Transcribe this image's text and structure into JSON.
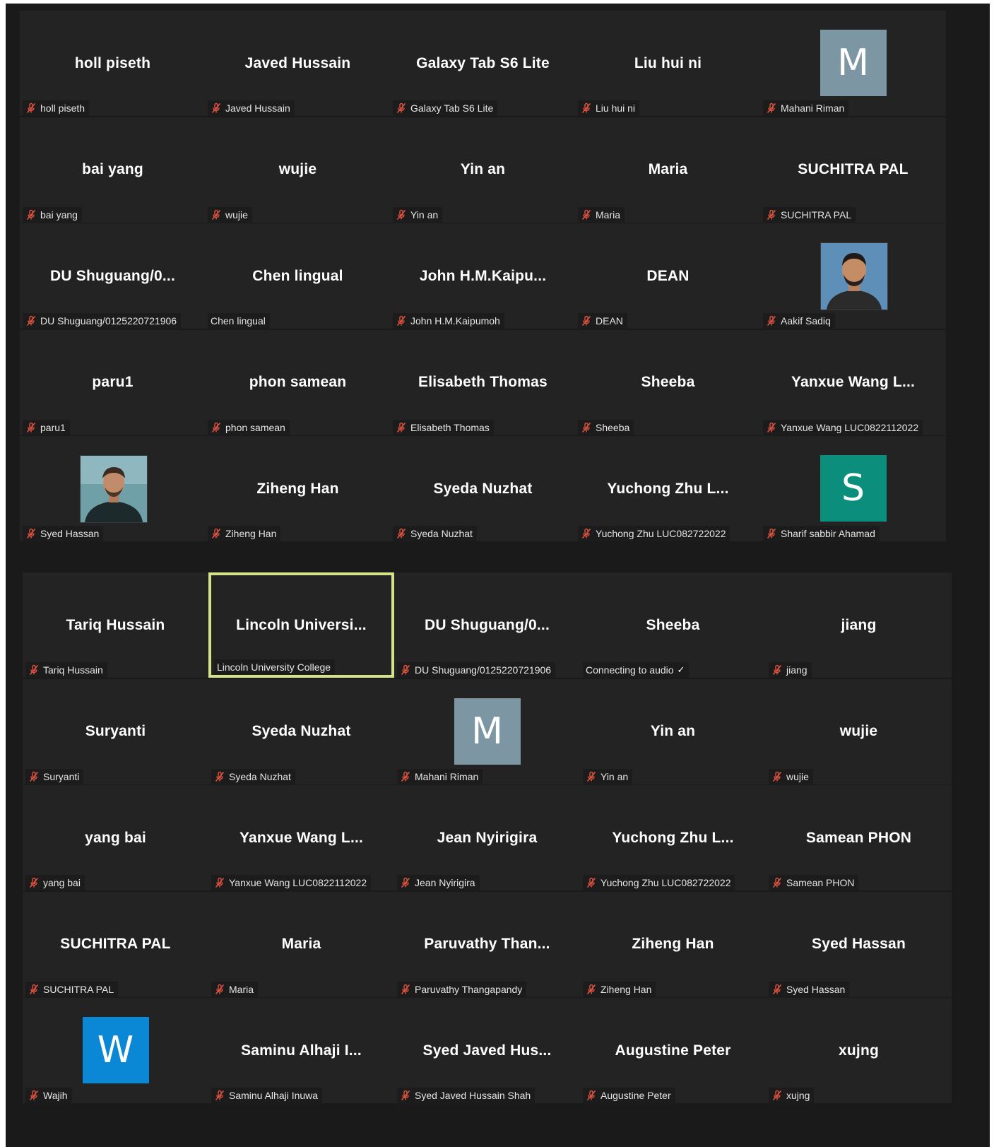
{
  "colors": {
    "background": "#1a1a1a",
    "tile": "#232323",
    "active_border": "#d3e38a",
    "mute_icon": "#e0533f",
    "avatar_gray": "#7d96a3",
    "avatar_teal": "#0c8e7d",
    "avatar_blue": "#0a88d6"
  },
  "top_grid": [
    {
      "display": "holl piseth",
      "label": "holl piseth",
      "muted": true
    },
    {
      "display": "Javed Hussain",
      "label": "Javed Hussain",
      "muted": true
    },
    {
      "display": "Galaxy Tab S6 Lite",
      "label": "Galaxy Tab S6 Lite",
      "muted": true
    },
    {
      "display": "Liu hui ni",
      "label": "Liu hui ni",
      "muted": true
    },
    {
      "display": "",
      "label": "Mahani Riman",
      "muted": true,
      "avatar": "M",
      "avatar_color": "#7d96a3"
    },
    {
      "display": "bai yang",
      "label": "bai yang",
      "muted": true
    },
    {
      "display": "wujie",
      "label": "wujie",
      "muted": true
    },
    {
      "display": "Yin an",
      "label": "Yin an",
      "muted": true
    },
    {
      "display": "Maria",
      "label": "Maria",
      "muted": true
    },
    {
      "display": "SUCHITRA PAL",
      "label": "SUCHITRA PAL",
      "muted": true
    },
    {
      "display": "DU  Shuguang/0...",
      "label": "DU Shuguang/0125220721906",
      "muted": true
    },
    {
      "display": "Chen lingual",
      "label": "Chen lingual",
      "muted": false
    },
    {
      "display": "John  H.M.Kaipu...",
      "label": "John H.M.Kaipumoh",
      "muted": true
    },
    {
      "display": "DEAN",
      "label": "DEAN",
      "muted": true
    },
    {
      "display": "",
      "label": "Aakif Sadiq",
      "muted": true,
      "photo": "profile-photo-a"
    },
    {
      "display": "paru1",
      "label": "paru1",
      "muted": true
    },
    {
      "display": "phon samean",
      "label": "phon samean",
      "muted": true
    },
    {
      "display": "Elisabeth Thomas",
      "label": "Elisabeth Thomas",
      "muted": true
    },
    {
      "display": "Sheeba",
      "label": "Sheeba",
      "muted": true
    },
    {
      "display": "Yanxue Wang L...",
      "label": "Yanxue Wang LUC0822112022",
      "muted": true
    },
    {
      "display": "",
      "label": "Syed Hassan",
      "muted": true,
      "photo": "profile-photo-b"
    },
    {
      "display": "Ziheng Han",
      "label": "Ziheng Han",
      "muted": true
    },
    {
      "display": "Syeda Nuzhat",
      "label": "Syeda Nuzhat",
      "muted": true
    },
    {
      "display": "Yuchong Zhu L...",
      "label": "Yuchong Zhu LUC082722022",
      "muted": true
    },
    {
      "display": "",
      "label": "Sharif sabbir Ahamad",
      "muted": true,
      "avatar": "S",
      "avatar_color": "#0c8e7d"
    }
  ],
  "bottom_grid": [
    {
      "display": "Tariq Hussain",
      "label": "Tariq Hussain",
      "muted": true
    },
    {
      "display": "Lincoln  Universi...",
      "label": "Lincoln University College",
      "muted": false,
      "active": true
    },
    {
      "display": "DU  Shuguang/0...",
      "label": "DU Shuguang/0125220721906",
      "muted": true
    },
    {
      "display": "Sheeba",
      "label": "Connecting to audio",
      "muted": false,
      "check": "✓"
    },
    {
      "display": "jiang",
      "label": "jiang",
      "muted": true
    },
    {
      "display": "Suryanti",
      "label": "Suryanti",
      "muted": true
    },
    {
      "display": "Syeda Nuzhat",
      "label": "Syeda Nuzhat",
      "muted": true
    },
    {
      "display": "",
      "label": "Mahani Riman",
      "muted": true,
      "avatar": "M",
      "avatar_color": "#7d96a3"
    },
    {
      "display": "Yin an",
      "label": "Yin an",
      "muted": true
    },
    {
      "display": "wujie",
      "label": "wujie",
      "muted": true
    },
    {
      "display": "yang bai",
      "label": "yang bai",
      "muted": true
    },
    {
      "display": "Yanxue Wang L...",
      "label": "Yanxue Wang LUC0822112022",
      "muted": true
    },
    {
      "display": "Jean Nyirigira",
      "label": "Jean Nyirigira",
      "muted": true
    },
    {
      "display": "Yuchong Zhu L...",
      "label": "Yuchong Zhu LUC082722022",
      "muted": true
    },
    {
      "display": "Samean PHON",
      "label": "Samean PHON",
      "muted": true
    },
    {
      "display": "SUCHITRA PAL",
      "label": "SUCHITRA PAL",
      "muted": true
    },
    {
      "display": "Maria",
      "label": "Maria",
      "muted": true
    },
    {
      "display": "Paruvathy  Than...",
      "label": "Paruvathy Thangapandy",
      "muted": true
    },
    {
      "display": "Ziheng Han",
      "label": "Ziheng Han",
      "muted": true
    },
    {
      "display": "Syed Hassan",
      "label": "Syed Hassan",
      "muted": true
    },
    {
      "display": "",
      "label": "Wajih",
      "muted": true,
      "avatar": "W",
      "avatar_color": "#0a88d6"
    },
    {
      "display": "Saminu  Alhaji  I...",
      "label": "Saminu Alhaji Inuwa",
      "muted": true
    },
    {
      "display": "Syed  Javed  Hus...",
      "label": "Syed Javed Hussain Shah",
      "muted": true
    },
    {
      "display": "Augustine Peter",
      "label": "Augustine Peter",
      "muted": true
    },
    {
      "display": "xujng",
      "label": "xujng",
      "muted": true
    }
  ]
}
